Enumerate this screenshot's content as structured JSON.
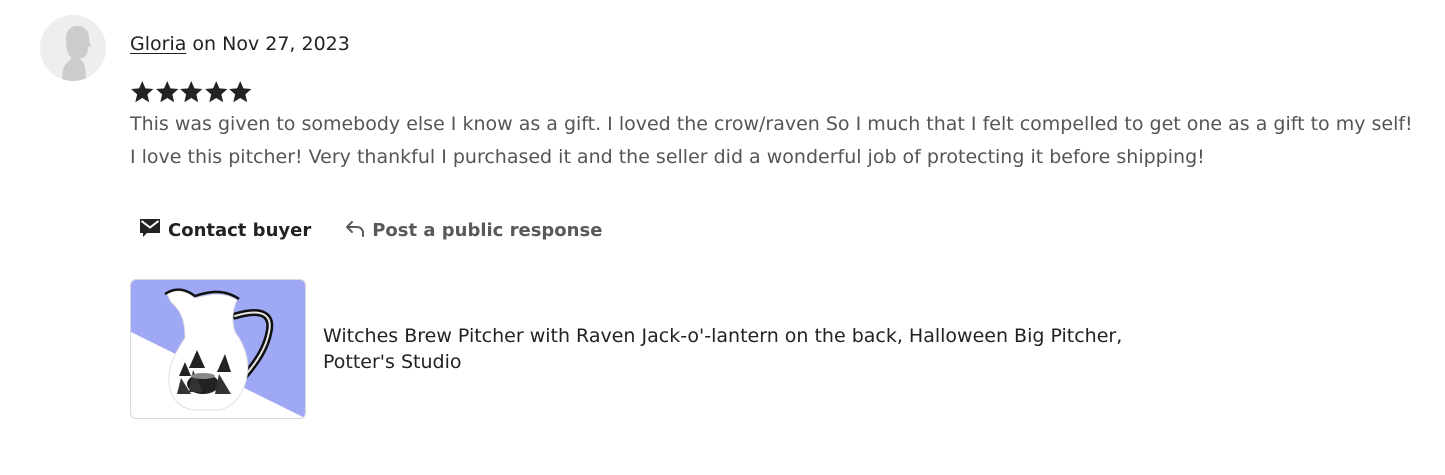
{
  "review": {
    "reviewer_name": "Gloria",
    "date_text": "on Nov 27, 2023",
    "rating": 5,
    "rating_max": 5,
    "star_color": "#222222",
    "text": "This was given to somebody else I know as a gift. I loved the crow/raven So I much that I felt compelled to get one as a gift to my self! I love this pitcher! Very thankful I purchased it and the seller did a wonderful job of protecting it before shipping!"
  },
  "actions": {
    "contact_label": "Contact buyer",
    "contact_icon": "envelope-icon",
    "response_label": "Post a public response",
    "response_icon": "reply-arrow-icon"
  },
  "product": {
    "title": "Witches Brew Pitcher with Raven Jack-o'-lantern on the back, Halloween Big Pitcher, Potter's Studio",
    "thumb_background_color": "#9fa8f5"
  }
}
